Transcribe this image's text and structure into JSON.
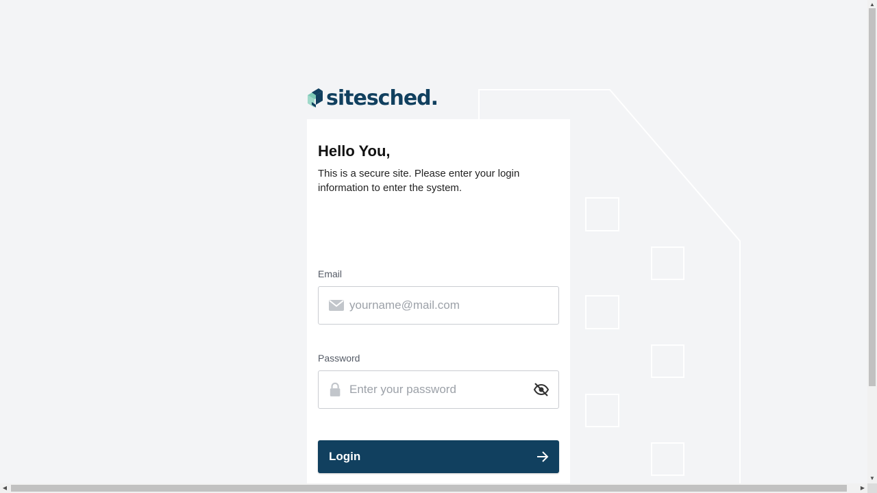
{
  "brand": {
    "name": "sitesched",
    "dot": "."
  },
  "card": {
    "greeting": "Hello You,",
    "intro": "This is a secure site. Please enter your login information to enter the system."
  },
  "form": {
    "email_label": "Email",
    "email_placeholder": "yourname@mail.com",
    "email_icon": "mail-icon",
    "password_label": "Password",
    "password_placeholder": "Enter your password",
    "password_icon": "lock-icon",
    "visibility_icon": "eye-off-icon",
    "login_label": "Login",
    "login_icon": "arrow-right-icon"
  },
  "colors": {
    "primary": "#11405f",
    "logo_accent": "#7cc9b6",
    "background": "#f3f4f6"
  }
}
